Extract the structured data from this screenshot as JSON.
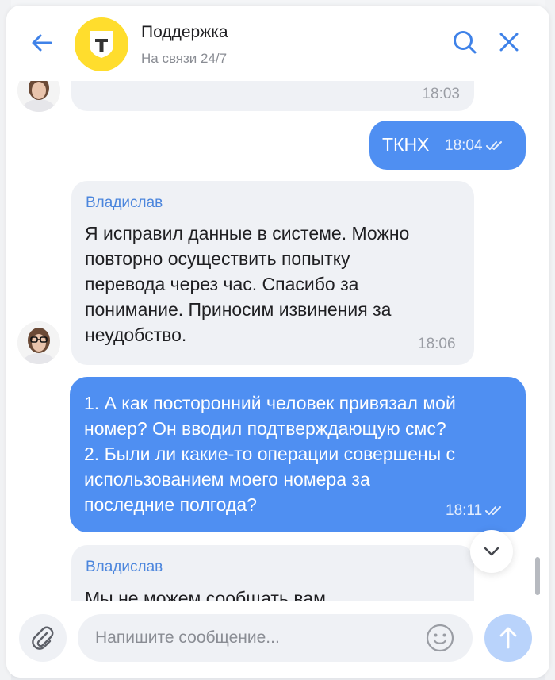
{
  "header": {
    "title": "Поддержка",
    "subtitle": "На связи 24/7",
    "logo_letter": "Т",
    "icons": {
      "back": "arrow-left-icon",
      "search": "search-icon",
      "close": "close-icon"
    }
  },
  "messages": [
    {
      "direction": "incoming",
      "sender": "",
      "text": "",
      "time": "18:03"
    },
    {
      "direction": "outgoing",
      "text": "ТКНХ",
      "time": "18:04",
      "status": "read"
    },
    {
      "direction": "incoming",
      "sender": "Владислав",
      "lines": [
        "Я исправил данные в системе. Можно",
        "повторно осуществить попытку",
        "перевода через час. Спасибо за",
        "понимание. Приносим извинения за",
        "неудобство."
      ],
      "time": "18:06"
    },
    {
      "direction": "outgoing",
      "lines": [
        "1. А как посторонний человек привязал мой",
        "номер? Он вводил подтверждающую смс?",
        "2. Были ли какие-то операции совершены с",
        "использованием моего номера за",
        "последние полгода?"
      ],
      "time": "18:11",
      "status": "read"
    },
    {
      "direction": "incoming",
      "sender": "Владислав",
      "lines": [
        "Мы не можем сообщать вам"
      ],
      "time": ""
    }
  ],
  "composer": {
    "placeholder": "Напишите сообщение...",
    "icons": {
      "attach": "paperclip-icon",
      "emoji": "emoji-icon",
      "send": "send-arrow-icon"
    }
  },
  "colors": {
    "accent": "#4f8ff2",
    "incoming_bubble": "#eff1f5",
    "brand_yellow": "#ffdd2d",
    "sender_name": "#4c86dd",
    "send_button_disabled": "#b9d3fb"
  }
}
